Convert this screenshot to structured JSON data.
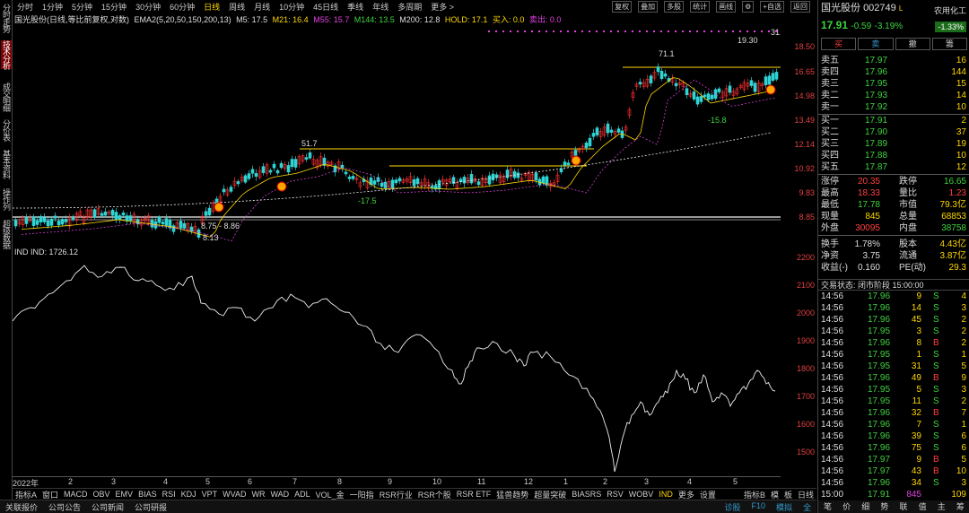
{
  "left_tabs": [
    "分时走势",
    "技术分析",
    "成交明细",
    "分价表",
    "基本资料",
    "操作列",
    "超级数据"
  ],
  "period_bar": [
    "分时",
    "1分钟",
    "5分钟",
    "15分钟",
    "30分钟",
    "60分钟",
    "日线",
    "周线",
    "月线",
    "10分钟",
    "45日线",
    "季线",
    "年线",
    "多周期",
    "更多 >"
  ],
  "active_period": "日线",
  "right_tools": [
    "复权",
    "叠加",
    "多股",
    "统计",
    "画线",
    "⚙",
    "+自选",
    "返回"
  ],
  "legend": {
    "name": "国光股份(日线,等比前复权,对数)",
    "ema": "EMA2(5,20,50,150,200,13)",
    "m5": "M5: 17.5",
    "m21": "M21: 16.4",
    "m55": "M55: 15.7",
    "m144": "M144: 13.5",
    "m200": "M200: 12.8",
    "hold": "HOLD: 17.1",
    "buy": "买入: 0.0",
    "sell": "卖出: 0.0"
  },
  "price_ticks": [
    "18.50",
    "16.65",
    "14.98",
    "13.49",
    "12.14",
    "10.92",
    "9.83",
    "8.85"
  ],
  "chart_annotations": {
    "high": "19.30",
    "peak_label": "71.1",
    "mid_label": "51.7",
    "low_label": "-15.8",
    "low2": "-17.5",
    "range_label": "8.75 - 8.86",
    "min_label": "8.13",
    "small": "31."
  },
  "indicator_legend": "IND  IND: 1726.12",
  "ind_ticks": [
    "2200",
    "2100",
    "2000",
    "1900",
    "1800",
    "1700",
    "1600",
    "1500"
  ],
  "x_labels": [
    "2022年",
    "2",
    "3",
    "4",
    "5",
    "6",
    "7",
    "8",
    "9",
    "10",
    "11",
    "12",
    "1",
    "2",
    "3",
    "4",
    "5"
  ],
  "indicator_tabs": [
    "指标A",
    "窗口",
    "MACD",
    "DMI",
    "DMA",
    "FSL",
    "TRIX",
    "BRAR",
    "CR",
    "VR",
    "OBV",
    "ASI",
    "EMV",
    "WVAD",
    "CCI",
    "RSI",
    "KDJ",
    "WR",
    "VPT",
    "BOLL",
    "更多",
    "设置"
  ],
  "indicator_bar": [
    "指标A",
    "窗口",
    "MACD",
    "OBV",
    "EMV",
    "BIAS",
    "RSI",
    "KDJ",
    "VPT",
    "WVAD",
    "WR",
    "WAD",
    "ADL",
    "VOL_金",
    "一阳指",
    "RSR行业",
    "RSR个股",
    "RSR ETF",
    "猛兽趋势",
    "超量突破",
    "BIASRS",
    "RSV",
    "WOBV",
    "IND",
    "更多",
    "设置"
  ],
  "indicator_bar_right": [
    "指标B",
    "模",
    "板",
    "日线"
  ],
  "news": [
    "关联报价",
    "公司公告",
    "公司新闻",
    "公司研报"
  ],
  "news_right": [
    "诊股",
    "F10",
    "模拟",
    "全"
  ],
  "quote": {
    "name": "国光股份",
    "code": "002749",
    "badge": "L",
    "price": "17.91",
    "change": "-0.59",
    "pct": "-3.19%",
    "sector": "农用化工",
    "sector_pct": "-1.33%"
  },
  "trade_buttons": [
    "买",
    "卖",
    "撤",
    "籌"
  ],
  "asks": [
    {
      "label": "卖五",
      "price": "17.97",
      "vol": "16"
    },
    {
      "label": "卖四",
      "price": "17.96",
      "vol": "144"
    },
    {
      "label": "卖三",
      "price": "17.95",
      "vol": "15"
    },
    {
      "label": "卖二",
      "price": "17.93",
      "vol": "14"
    },
    {
      "label": "卖一",
      "price": "17.92",
      "vol": "10"
    }
  ],
  "bids": [
    {
      "label": "买一",
      "price": "17.91",
      "vol": "2"
    },
    {
      "label": "买二",
      "price": "17.90",
      "vol": "37"
    },
    {
      "label": "买三",
      "price": "17.89",
      "vol": "19"
    },
    {
      "label": "买四",
      "price": "17.88",
      "vol": "10"
    },
    {
      "label": "买五",
      "price": "17.87",
      "vol": "12"
    }
  ],
  "stats": [
    [
      "涨停",
      "20.35",
      "跌停",
      "16.65"
    ],
    [
      "最高",
      "18.33",
      "量比",
      "1.23"
    ],
    [
      "最低",
      "17.78",
      "市值",
      "79.3亿"
    ],
    [
      "现量",
      "845",
      "总量",
      "68853"
    ],
    [
      "外盘",
      "30095",
      "内盘",
      "38758"
    ],
    [
      "换手",
      "1.78%",
      "股本",
      "4.43亿"
    ],
    [
      "净资",
      "3.75",
      "流通",
      "3.87亿"
    ],
    [
      "收益(-)",
      "0.160",
      "PE(动)",
      "29.3"
    ]
  ],
  "trade_status": "交易状态: 闭市阶段 15:00:00",
  "ticks": [
    [
      "14:56",
      "17.96",
      "9",
      "S",
      "4"
    ],
    [
      "14:56",
      "17.96",
      "14",
      "S",
      "3"
    ],
    [
      "14:56",
      "17.96",
      "45",
      "S",
      "2"
    ],
    [
      "14:56",
      "17.95",
      "3",
      "S",
      "2"
    ],
    [
      "14:56",
      "17.96",
      "8",
      "B",
      "2"
    ],
    [
      "14:56",
      "17.95",
      "1",
      "S",
      "1"
    ],
    [
      "14:56",
      "17.95",
      "31",
      "S",
      "5"
    ],
    [
      "14:56",
      "17.96",
      "49",
      "B",
      "9"
    ],
    [
      "14:56",
      "17.95",
      "5",
      "S",
      "3"
    ],
    [
      "14:56",
      "17.95",
      "11",
      "S",
      "2"
    ],
    [
      "14:56",
      "17.96",
      "32",
      "B",
      "7"
    ],
    [
      "14:56",
      "17.96",
      "7",
      "S",
      "1"
    ],
    [
      "14:56",
      "17.96",
      "39",
      "S",
      "6"
    ],
    [
      "14:56",
      "17.96",
      "75",
      "S",
      "6"
    ],
    [
      "14:56",
      "17.97",
      "9",
      "B",
      "5"
    ],
    [
      "14:56",
      "17.97",
      "43",
      "B",
      "10"
    ],
    [
      "14:56",
      "17.96",
      "34",
      "S",
      "3"
    ],
    [
      "15:00",
      "17.91",
      "845",
      "",
      "109"
    ]
  ],
  "bottom_tabs": [
    "笔",
    "价",
    "细",
    "势",
    "联",
    "值",
    "主",
    "筹"
  ]
}
